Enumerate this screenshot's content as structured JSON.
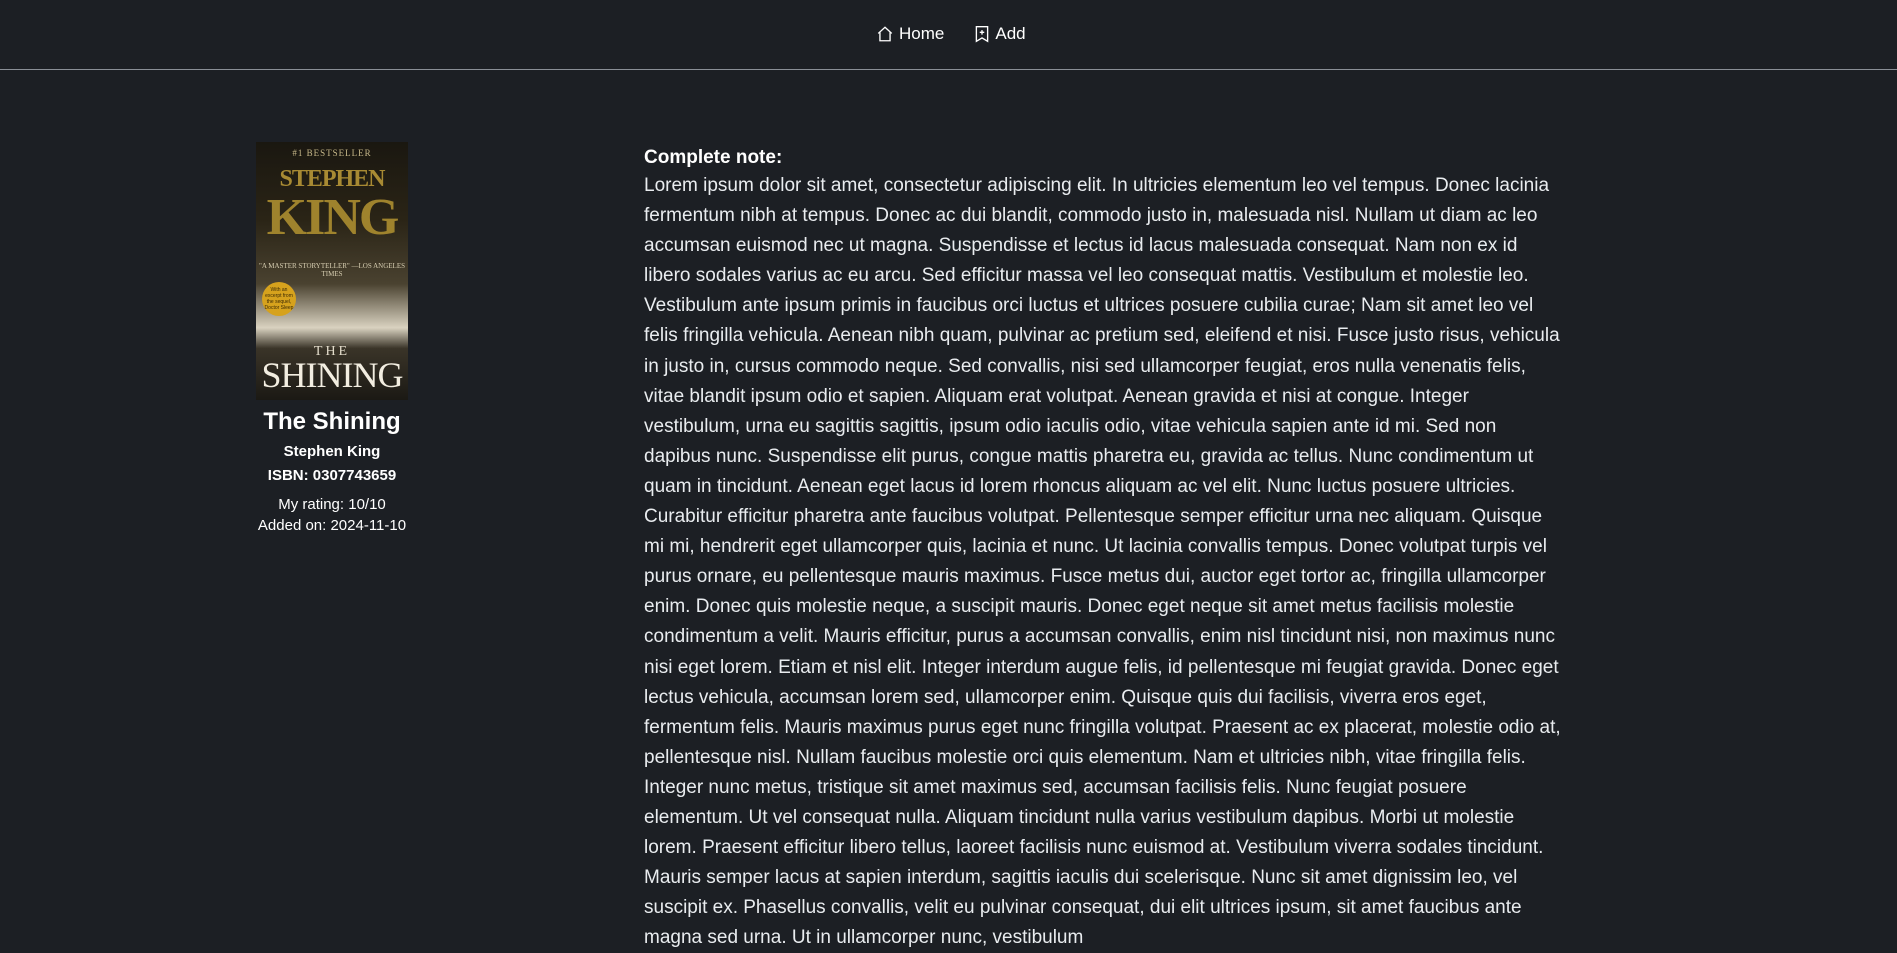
{
  "nav": {
    "items": [
      {
        "label": "Home",
        "icon": "house-icon"
      },
      {
        "label": "Add",
        "icon": "bookmark-plus-icon"
      }
    ]
  },
  "book": {
    "cover": {
      "top_line": "#1 BESTSELLER",
      "author_first": "STEPHEN",
      "author_last": "KING",
      "tagline": "\"A MASTER STORYTELLER\" —LOS ANGELES TIMES",
      "badge": "With an excerpt from the sequel, Doctor Sleep",
      "title_small": "THE",
      "title_large": "SHINING"
    },
    "title": "The Shining",
    "author": "Stephen King",
    "isbn": "ISBN: 0307743659",
    "rating": "My rating: 10/10",
    "added": "Added on: 2024-11-10"
  },
  "note": {
    "heading": "Complete note:",
    "body": "Lorem ipsum dolor sit amet, consectetur adipiscing elit. In ultricies elementum leo vel tempus. Donec lacinia fermentum nibh at tempus. Donec ac dui blandit, commodo justo in, malesuada nisl. Nullam ut diam ac leo accumsan euismod nec ut magna. Suspendisse et lectus id lacus malesuada consequat. Nam non ex id libero sodales varius ac eu arcu. Sed efficitur massa vel leo consequat mattis. Vestibulum et molestie leo. Vestibulum ante ipsum primis in faucibus orci luctus et ultrices posuere cubilia curae; Nam sit amet leo vel felis fringilla vehicula. Aenean nibh quam, pulvinar ac pretium sed, eleifend et nisi. Fusce justo risus, vehicula in justo in, cursus commodo neque. Sed convallis, nisi sed ullamcorper feugiat, eros nulla venenatis felis, vitae blandit ipsum odio et sapien. Aliquam erat volutpat. Aenean gravida et nisi at congue. Integer vestibulum, urna eu sagittis sagittis, ipsum odio iaculis odio, vitae vehicula sapien ante id mi. Sed non dapibus nunc. Suspendisse elit purus, congue mattis pharetra eu, gravida ac tellus. Nunc condimentum ut quam in tincidunt. Aenean eget lacus id lorem rhoncus aliquam ac vel elit. Nunc luctus posuere ultricies. Curabitur efficitur pharetra ante faucibus volutpat. Pellentesque semper efficitur urna nec aliquam. Quisque mi mi, hendrerit eget ullamcorper quis, lacinia et nunc. Ut lacinia convallis tempus. Donec volutpat turpis vel purus ornare, eu pellentesque mauris maximus. Fusce metus dui, auctor eget tortor ac, fringilla ullamcorper enim. Donec quis molestie neque, a suscipit mauris. Donec eget neque sit amet metus facilisis molestie condimentum a velit. Mauris efficitur, purus a accumsan convallis, enim nisl tincidunt nisi, non maximus nunc nisi eget lorem. Etiam et nisl elit. Integer interdum augue felis, id pellentesque mi feugiat gravida. Donec eget lectus vehicula, accumsan lorem sed, ullamcorper enim. Quisque quis dui facilisis, viverra eros eget, fermentum felis. Mauris maximus purus eget nunc fringilla volutpat. Praesent ac ex placerat, molestie odio at, pellentesque nisl. Nullam faucibus molestie orci quis elementum. Nam et ultricies nibh, vitae fringilla felis. Integer nunc metus, tristique sit amet maximus sed, accumsan facilisis felis. Nunc feugiat posuere elementum. Ut vel consequat nulla. Aliquam tincidunt nulla varius vestibulum dapibus. Morbi ut molestie lorem. Praesent efficitur libero tellus, laoreet facilisis nunc euismod at. Vestibulum viverra sodales tincidunt. Mauris semper lacus at sapien interdum, sagittis iaculis dui scelerisque. Nunc sit amet dignissim leo, vel suscipit ex. Phasellus convallis, velit eu pulvinar consequat, dui elit ultrices ipsum, sit amet faucibus ante magna sed urna. Ut in ullamcorper nunc, vestibulum"
  },
  "colors": {
    "background": "#1c1f24",
    "text": "#e9ecef",
    "divider": "#8a8f96"
  }
}
